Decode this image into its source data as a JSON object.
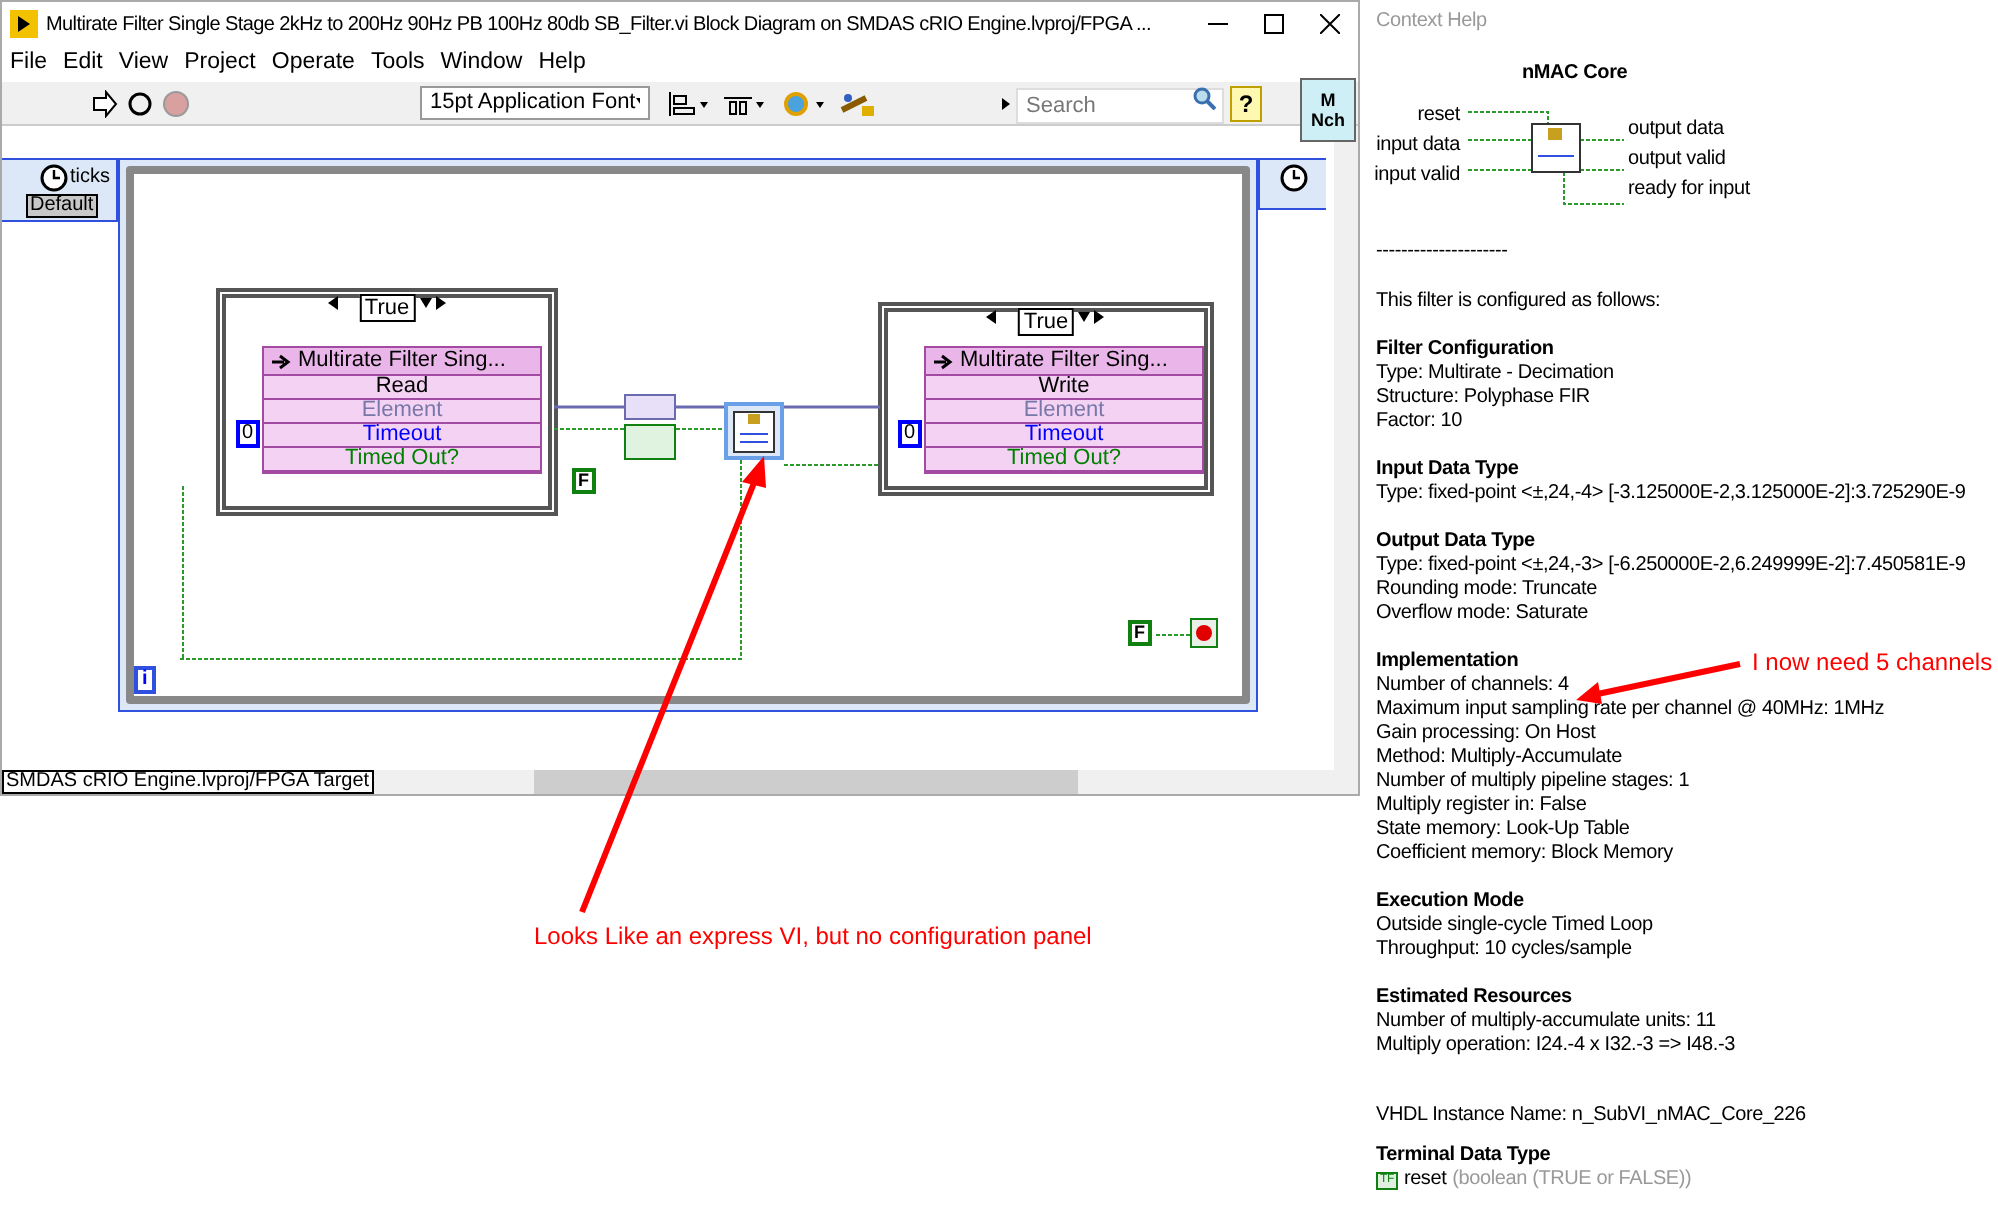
{
  "window": {
    "title": "Multirate Filter Single Stage 2kHz to 200Hz 90Hz PB 100Hz 80db SB_Filter.vi Block Diagram on SMDAS cRIO Engine.lvproj/FPGA ..."
  },
  "menu": [
    "File",
    "Edit",
    "View",
    "Project",
    "Operate",
    "Tools",
    "Window",
    "Help"
  ],
  "toolbar": {
    "font": "15pt Application Font",
    "search": {
      "placeholder": "Search"
    },
    "help": "?",
    "vi_icon": [
      "M",
      "Nch"
    ]
  },
  "diagram": {
    "loop_source": {
      "label": "ticks",
      "value": "Default"
    },
    "cases": [
      {
        "selector": "True",
        "node_title": "Multirate Filter Sing...",
        "method": "Read",
        "constant": "0",
        "terminals": [
          {
            "label": "Element",
            "kind": "data"
          },
          {
            "label": "Timeout",
            "kind": "numeric"
          },
          {
            "label": "Timed Out?",
            "kind": "boolean"
          }
        ]
      },
      {
        "selector": "True",
        "node_title": "Multirate Filter Sing...",
        "method": "Write",
        "constant": "0",
        "terminals": [
          {
            "label": "Element",
            "kind": "data"
          },
          {
            "label": "Timeout",
            "kind": "numeric"
          },
          {
            "label": "Timed Out?",
            "kind": "boolean"
          }
        ]
      }
    ],
    "false_constants": [
      "F",
      "F"
    ],
    "iteration": "i"
  },
  "status_bar": {
    "context": "SMDAS cRIO Engine.lvproj/FPGA Target"
  },
  "context_help": {
    "title": "Context Help",
    "heading": "nMAC Core",
    "left_terminals": [
      "reset",
      "input data",
      "input valid"
    ],
    "right_terminals": [
      "output data",
      "output valid",
      "ready for input"
    ],
    "separator": "---------------------",
    "intro": "This filter is configured as follows:",
    "sections": [
      {
        "heading": "Filter Configuration",
        "lines": [
          "Type:  Multirate -  Decimation",
          "Structure:  Polyphase FIR",
          "Factor: 10"
        ]
      },
      {
        "heading": "Input Data Type",
        "lines": [
          "Type: fixed-point <±,24,-4> [-3.125000E-2,3.125000E-2]:3.725290E-9"
        ]
      },
      {
        "heading": "Output Data Type",
        "lines": [
          "Type: fixed-point <±,24,-3> [-6.250000E-2,6.249999E-2]:7.450581E-9",
          "Rounding mode: Truncate",
          "Overflow mode: Saturate"
        ]
      },
      {
        "heading": "Implementation",
        "lines": [
          "Number of channels: 4",
          "Maximum input sampling rate per channel @ 40MHz: 1MHz",
          "Gain processing: On Host",
          "Method: Multiply-Accumulate",
          "Number of multiply pipeline stages: 1",
          "Multiply register in: False",
          "State memory: Look-Up Table",
          "Coefficient memory: Block Memory"
        ]
      },
      {
        "heading": "Execution Mode",
        "lines": [
          "Outside single-cycle Timed Loop",
          "Throughput: 10 cycles/sample"
        ]
      },
      {
        "heading": "Estimated Resources",
        "lines": [
          "Number of multiply-accumulate units: 11",
          "Multiply operation: I24.-4 x I32.-3 => I48.-3"
        ]
      }
    ],
    "vhdl": "VHDL Instance Name: n_SubVI_nMAC_Core_226",
    "terminal_type": {
      "heading": "Terminal Data Type",
      "badge": "TF",
      "name": "reset",
      "type": "(boolean (TRUE or FALSE))"
    }
  },
  "annotations": [
    {
      "text": "Looks Like an express VI, but no configuration panel"
    },
    {
      "text": "I now need 5 channels"
    }
  ]
}
